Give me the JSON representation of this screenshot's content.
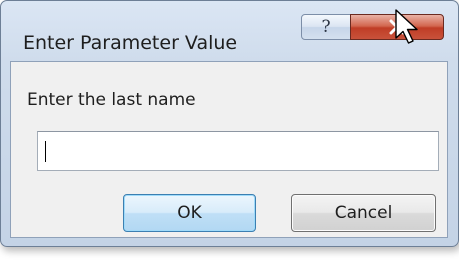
{
  "dialog": {
    "title": "Enter Parameter Value",
    "help_symbol": "?",
    "prompt": "Enter the last name",
    "input_value": "",
    "ok_label": "OK",
    "cancel_label": "Cancel"
  },
  "icons": {
    "help": "question-mark-icon",
    "close": "close-x-icon",
    "pointer": "mouse-cursor-icon"
  },
  "colors": {
    "window_frame": "#cfdcec",
    "close_button": "#c03d26",
    "ok_button_border": "#3c7fb1"
  }
}
